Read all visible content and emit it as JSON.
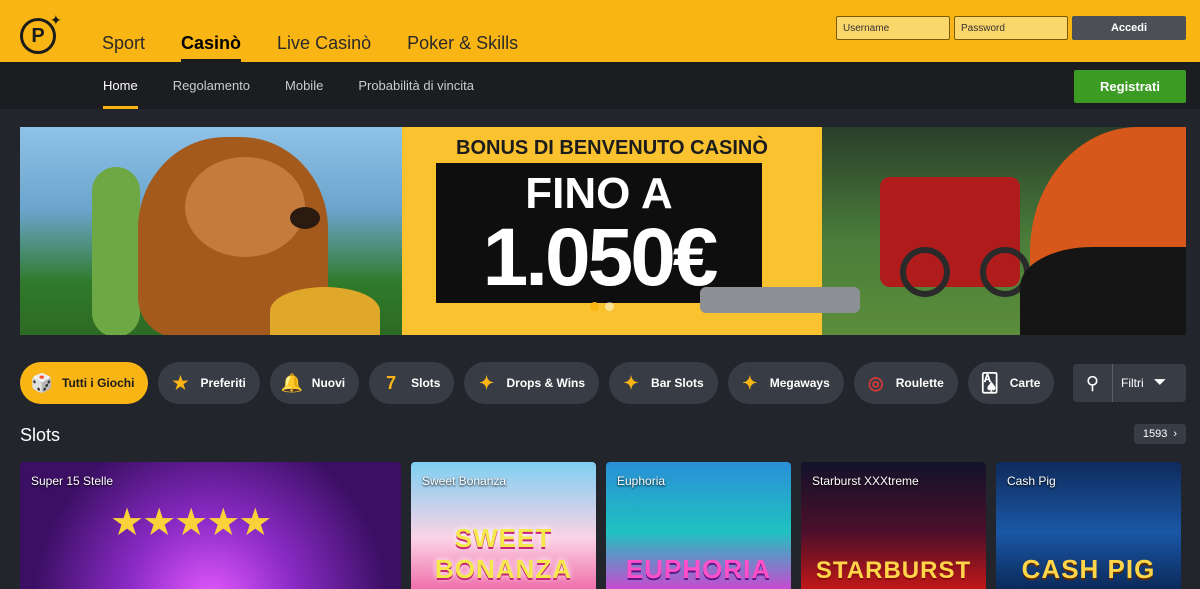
{
  "topbar": {
    "logo_letter": "P",
    "nav": [
      {
        "label": "Sport"
      },
      {
        "label": "Casinò"
      },
      {
        "label": "Live Casinò"
      },
      {
        "label": "Poker & Skills"
      }
    ],
    "login": {
      "username_placeholder": "Username",
      "password_placeholder": "Password",
      "submit_label": "Accedi"
    }
  },
  "subnav": {
    "items": [
      {
        "label": "Home"
      },
      {
        "label": "Regolamento"
      },
      {
        "label": "Mobile"
      },
      {
        "label": "Probabilità di vincita"
      }
    ],
    "register_label": "Registrati"
  },
  "banner": {
    "title": "BONUS DI BENVENUTO CASINÒ",
    "line1": "FINO A",
    "line2": "1.050€",
    "slides": 2,
    "active_slide": 1
  },
  "filters": {
    "chips": [
      {
        "label": "Tutti i Giochi",
        "icon": "dice-cards-icon"
      },
      {
        "label": "Preferiti",
        "icon": "star-icon"
      },
      {
        "label": "Nuovi",
        "icon": "bell-icon"
      },
      {
        "label": "Slots",
        "icon": "seven-cherry-icon"
      },
      {
        "label": "Drops & Wins",
        "icon": "sparkle-icon"
      },
      {
        "label": "Bar Slots",
        "icon": "sparkle-icon"
      },
      {
        "label": "Megaways",
        "icon": "sparkle-icon"
      },
      {
        "label": "Roulette",
        "icon": "roulette-icon"
      },
      {
        "label": "Carte",
        "icon": "cards-icon"
      }
    ],
    "search_filter_label": "Filtri"
  },
  "section": {
    "title": "Slots",
    "count": "1593"
  },
  "games": [
    {
      "name": "Super 15 Stelle",
      "art": ""
    },
    {
      "name": "Sweet Bonanza",
      "art": "SWEET BONANZA"
    },
    {
      "name": "Euphoria",
      "art": "EUPHORIA"
    },
    {
      "name": "Starburst XXXtreme",
      "art": "STARBURST"
    },
    {
      "name": "Cash Pig",
      "art": "CASH PIG"
    }
  ],
  "colors": {
    "brand_yellow": "#f9b513",
    "register_green": "#3b9b23",
    "dark_bg": "#22252b"
  }
}
